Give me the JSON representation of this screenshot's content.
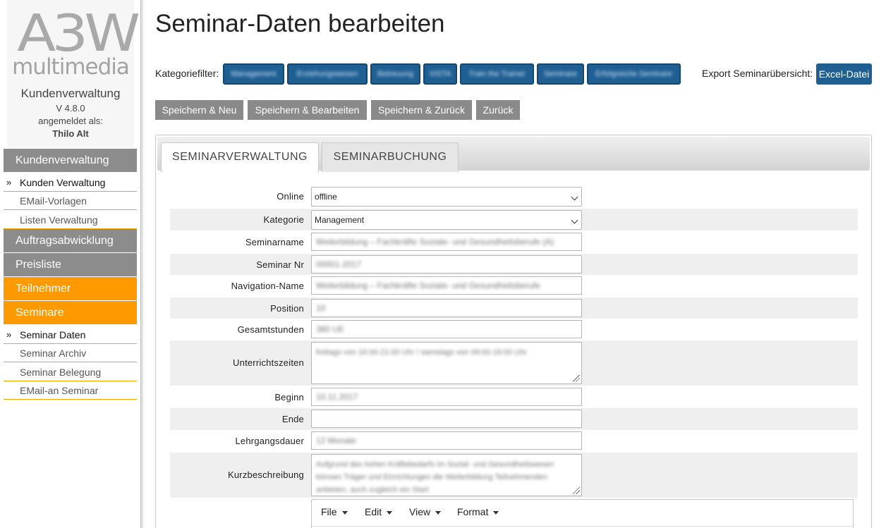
{
  "sidebar": {
    "logo_top": "A3W",
    "logo_bottom": "multimedia",
    "app_name": "Kundenverwaltung",
    "version": "V 4.8.0",
    "logged_in_label": "angemeldet als:",
    "user": "Thilo Alt",
    "menu": {
      "kundenverwaltung": "Kundenverwaltung",
      "kunden_verwaltung": "Kunden Verwaltung",
      "email_vorlagen": "EMail-Vorlagen",
      "listen_verwaltung": "Listen Verwaltung",
      "auftragsabwicklung": "Auftragsabwicklung",
      "preisliste": "Preisliste",
      "teilnehmer": "Teilnehmer",
      "seminare": "Seminare",
      "seminar_daten": "Seminar Daten",
      "seminar_archiv": "Seminar Archiv",
      "seminar_belegung": "Seminar Belegung",
      "email_an_seminar": "EMail-an Seminar"
    },
    "active_marker": "»",
    "colors": {
      "gray": "#8c8c8c",
      "orange": "#ff9900"
    }
  },
  "header": {
    "title": "Seminar-Daten bearbeiten",
    "filter_label": "Kategoriefilter:",
    "filters": [
      "Management",
      "Erziehungswesen",
      "Betreuung",
      "VISTA",
      "Train the Trainer",
      "Seminare",
      "Erfolgreiche Seminare"
    ],
    "export_label": "Export Seminarübersicht:",
    "export_button": "Excel-Datei"
  },
  "actions": {
    "save_new": "Speichern & Neu",
    "save_edit": "Speichern & Bearbeiten",
    "save_back": "Speichern & Zurück",
    "back": "Zurück"
  },
  "tabs": {
    "verwaltung": "SEMINARVERWALTUNG",
    "buchung": "SEMINARBUCHUNG"
  },
  "form": {
    "online": {
      "label": "Online",
      "value": "offline"
    },
    "kategorie": {
      "label": "Kategorie",
      "value": "Management"
    },
    "seminarname": {
      "label": "Seminarname",
      "value": "Weiterbildung – Fachkräfte Soziale- und Gesundheitsberufe (A)"
    },
    "seminar_nr": {
      "label": "Seminar Nr",
      "value": "00001-2017"
    },
    "navigation_name": {
      "label": "Navigation-Name",
      "value": "Weiterbildung – Fachkräfte Soziale- und Gesundheitsberufe"
    },
    "position": {
      "label": "Position",
      "value": "10"
    },
    "gesamtstunden": {
      "label": "Gesamtstunden",
      "value": "380 UE"
    },
    "unterrichtszeiten": {
      "label": "Unterrichtszeiten",
      "value": "freitags von 16:00-21:00 Uhr / samstags von 09:00-16:00 Uhr"
    },
    "beginn": {
      "label": "Beginn",
      "value": "10.11.2017"
    },
    "ende": {
      "label": "Ende",
      "value": ""
    },
    "lehrgangsdauer": {
      "label": "Lehrgangsdauer",
      "value": "12 Monate"
    },
    "kurzbeschreibung": {
      "label": "Kurzbeschreibung",
      "value": "Aufgrund des hohen Kräftebedarfs im Sozial- und Gesundheitswesen können Träger und Einrichtungen die Weiterbildung Teilnehmenden anbieten, auch zugleich ein Start"
    }
  },
  "editor": {
    "menus": [
      "File",
      "Edit",
      "View",
      "Format"
    ]
  }
}
